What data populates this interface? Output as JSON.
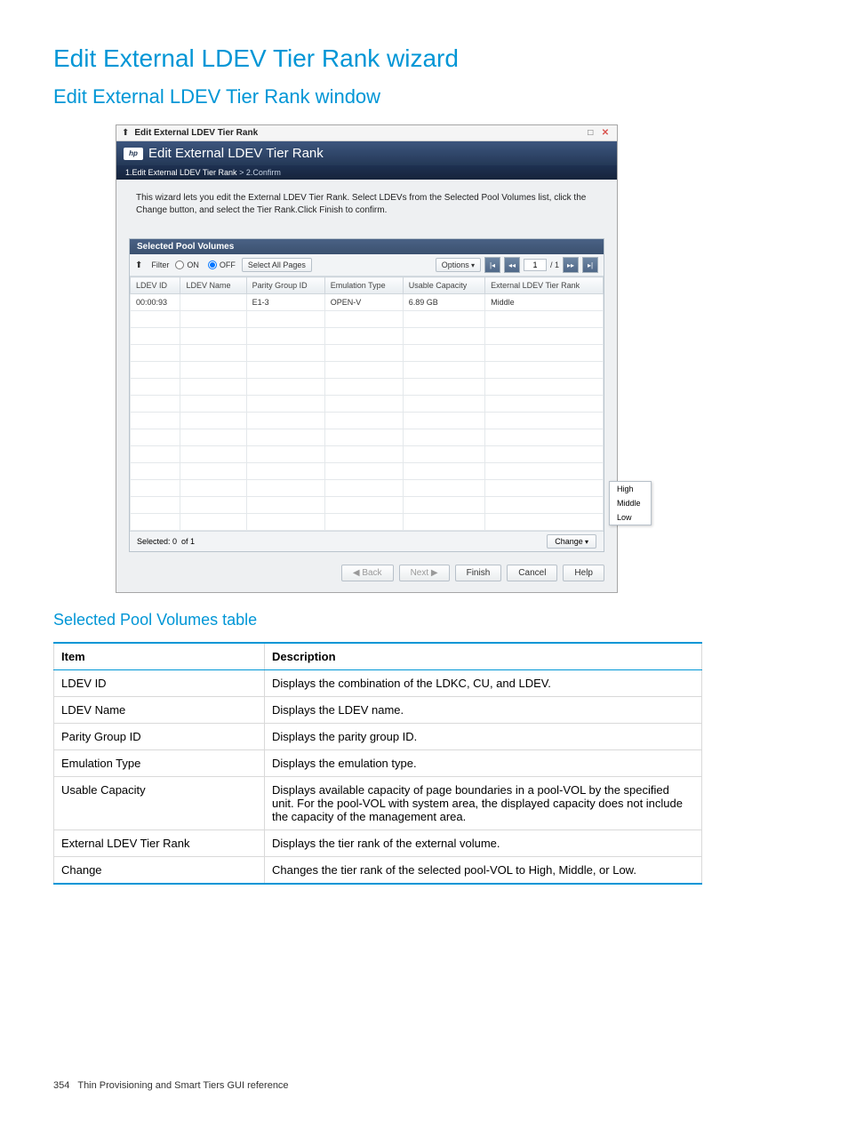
{
  "headings": {
    "h1": "Edit External LDEV Tier Rank wizard",
    "h2": "Edit External LDEV Tier Rank window",
    "h3": "Selected Pool Volumes table"
  },
  "wizard": {
    "titlebar": "Edit External LDEV Tier Rank",
    "header": "Edit External LDEV Tier Rank",
    "logo": "hp",
    "steps": {
      "active": "1.Edit External LDEV Tier Rank",
      "sep": ">",
      "next": "2.Confirm"
    },
    "description": "This wizard lets you edit the External LDEV Tier Rank. Select LDEVs from the Selected Pool Volumes list, click the Change button, and select the Tier Rank.Click Finish to confirm.",
    "panel_title": "Selected Pool Volumes",
    "filter_label": "Filter",
    "filter_on": "ON",
    "filter_off": "OFF",
    "select_all_pages": "Select All Pages",
    "options": "Options",
    "page_value": "1",
    "page_total": "/ 1",
    "columns": [
      "LDEV ID",
      "LDEV Name",
      "Parity Group ID",
      "Emulation Type",
      "Usable Capacity",
      "External LDEV Tier Rank"
    ],
    "rows": [
      {
        "ldev_id": "00:00:93",
        "ldev_name": "",
        "pg_id": "E1-3",
        "emu": "OPEN-V",
        "cap": "6.89 GB",
        "rank": "Middle"
      }
    ],
    "selected_label": "Selected: 0",
    "of_label": "of 1",
    "change_label": "Change",
    "change_menu": [
      "High",
      "Middle",
      "Low"
    ],
    "buttons": {
      "back": "Back",
      "next": "Next",
      "finish": "Finish",
      "cancel": "Cancel",
      "help": "Help"
    }
  },
  "desc_table": {
    "headers": [
      "Item",
      "Description"
    ],
    "rows": [
      [
        "LDEV ID",
        "Displays the combination of the LDKC, CU, and LDEV."
      ],
      [
        "LDEV Name",
        "Displays the LDEV name."
      ],
      [
        "Parity Group ID",
        "Displays the parity group ID."
      ],
      [
        "Emulation Type",
        "Displays the emulation type."
      ],
      [
        "Usable Capacity",
        "Displays available capacity of page boundaries in a pool-VOL by the specified unit. For the pool-VOL with system area, the displayed capacity does not include the capacity of the management area."
      ],
      [
        "External LDEV Tier Rank",
        "Displays the tier rank of the external volume."
      ],
      [
        "Change",
        "Changes the tier rank of the selected pool-VOL to High, Middle, or Low."
      ]
    ]
  },
  "footer": {
    "page_no": "354",
    "section": "Thin Provisioning and Smart Tiers GUI reference"
  }
}
